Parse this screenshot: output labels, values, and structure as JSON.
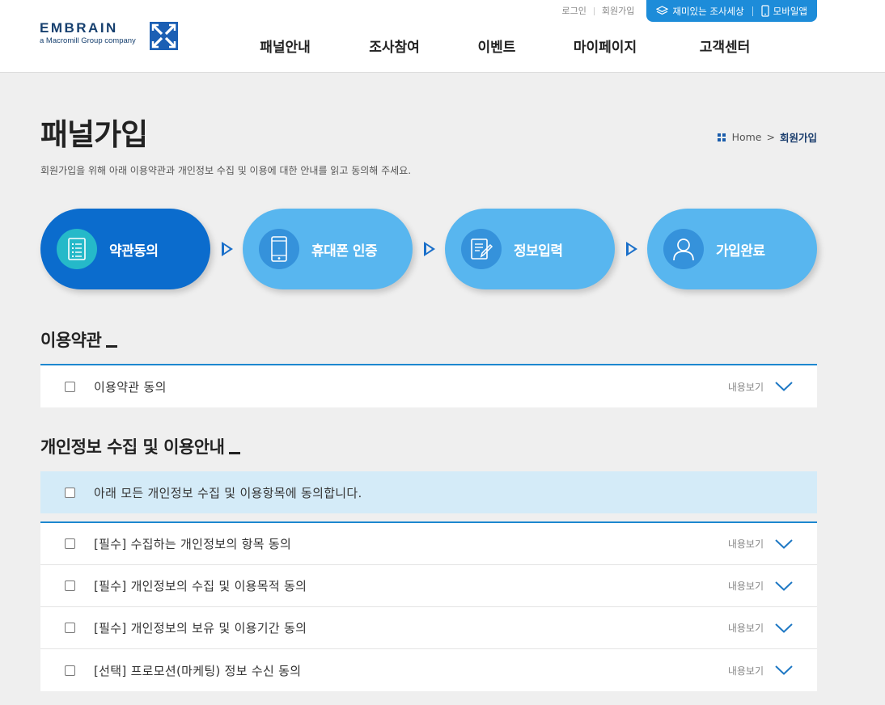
{
  "brand": {
    "name": "EMBRAIN",
    "tagline": "a Macromill Group company",
    "accent_color": "#1d8cd9"
  },
  "header": {
    "util_links": [
      "로그인",
      "회원가입"
    ],
    "util_pill": {
      "survey": {
        "label": "재미있는 조사세상",
        "icon": "layers-icon"
      },
      "mobile": {
        "label": "모바일앱",
        "icon": "mobile-icon"
      }
    },
    "nav": [
      "패널안내",
      "조사참여",
      "이벤트",
      "마이페이지",
      "고객센터"
    ]
  },
  "page": {
    "title": "패널가입",
    "description": "회원가입을 위해 아래 이용약관과 개인정보 수집 및 이용에 대한 안내를 읽고 동의해 주세요.",
    "breadcrumb": {
      "home": "Home",
      "separator": ">",
      "current": "회원가입"
    }
  },
  "steps": [
    {
      "label": "약관동의",
      "icon": "document-list-icon",
      "active": true
    },
    {
      "label": "휴대폰 인증",
      "icon": "smartphone-icon",
      "active": false
    },
    {
      "label": "정보입력",
      "icon": "edit-document-icon",
      "active": false
    },
    {
      "label": "가입완료",
      "icon": "user-icon",
      "active": false
    }
  ],
  "terms_section": {
    "title": "이용약관",
    "items": [
      {
        "label": "이용약관 동의",
        "view_label": "내용보기"
      }
    ]
  },
  "privacy_section": {
    "title": "개인정보 수집 및 이용안내",
    "agree_all": "아래 모든 개인정보 수집 및 이용항목에 동의합니다.",
    "items": [
      {
        "label": "[필수] 수집하는 개인정보의 항목 동의",
        "view_label": "내용보기"
      },
      {
        "label": "[필수] 개인정보의 수집 및 이용목적 동의",
        "view_label": "내용보기"
      },
      {
        "label": "[필수] 개인정보의 보유 및 이용기간 동의",
        "view_label": "내용보기"
      },
      {
        "label": "[선택] 프로모션(마케팅) 정보 수신 동의",
        "view_label": "내용보기"
      }
    ]
  }
}
